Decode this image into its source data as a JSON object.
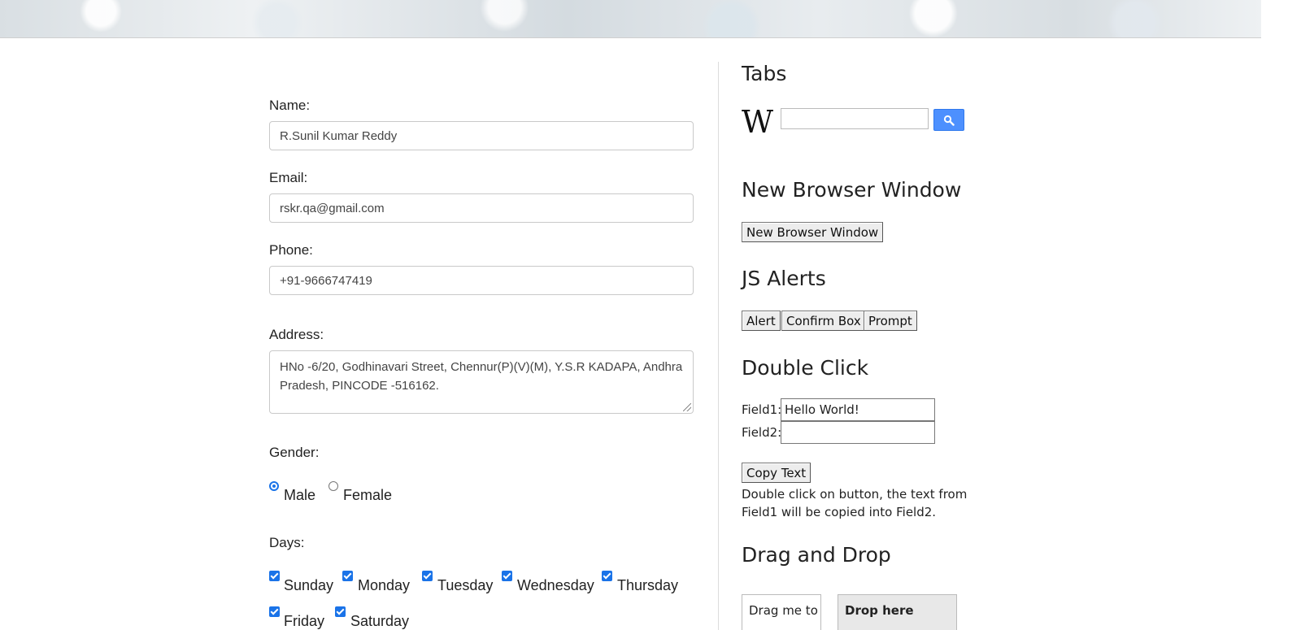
{
  "form": {
    "name_label": "Name:",
    "name_value": "R.Sunil Kumar Reddy",
    "email_label": "Email:",
    "email_value": "rskr.qa@gmail.com",
    "phone_label": "Phone:",
    "phone_value": "+91-9666747419",
    "address_label": "Address:",
    "address_value": "HNo -6/20, Godhinavari Street, Chennur(P)(V)(M), Y.S.R KADAPA, Andhra Pradesh, PINCODE -516162.",
    "gender_label": "Gender:",
    "gender_options": [
      {
        "label": "Male",
        "selected": true
      },
      {
        "label": "Female",
        "selected": false
      }
    ],
    "days_label": "Days:",
    "days": [
      {
        "label": "Sunday",
        "checked": true
      },
      {
        "label": "Monday",
        "checked": true
      },
      {
        "label": "Tuesday",
        "checked": true
      },
      {
        "label": "Wednesday",
        "checked": true
      },
      {
        "label": "Thursday",
        "checked": true
      },
      {
        "label": "Friday",
        "checked": true
      },
      {
        "label": "Saturday",
        "checked": true
      }
    ]
  },
  "side": {
    "tabs_heading": "Tabs",
    "wiki_logo": "W",
    "wiki_search_value": "",
    "new_window_heading": "New Browser Window",
    "new_window_button": "New Browser Window",
    "alerts_heading": "JS Alerts",
    "alert_button": "Alert",
    "confirm_button": "Confirm Box",
    "prompt_button": "Prompt",
    "double_click_heading": "Double Click",
    "field1_label": "Field1:",
    "field1_value": "Hello World!",
    "field2_label": "Field2:",
    "field2_value": "",
    "copy_button": "Copy Text",
    "double_click_note": "Double click on button, the text from Field1 will be copied into Field2.",
    "drag_drop_heading": "Drag and Drop",
    "drag_label": "Drag me to",
    "drop_label": "Drop here"
  },
  "colors": {
    "accent": "#1a73e8",
    "search_button": "#4d90fe"
  }
}
